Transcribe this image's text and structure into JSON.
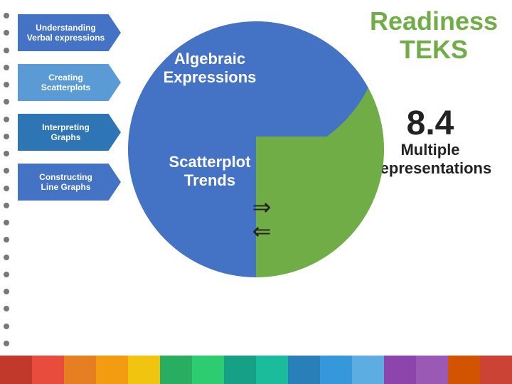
{
  "page": {
    "title": "Readiness TEKS",
    "subtitle_number": "8.4",
    "subtitle_label": "Multiple\nRepresentations",
    "readiness_line1": "Readiness",
    "readiness_line2": "TEKS",
    "circle": {
      "text1_line1": "Algebraic",
      "text1_line2": "Expressions",
      "text2_line1": "Scatterplot",
      "text2_line2": "Trends"
    },
    "arrows": [
      {
        "label": "Understanding\nVerbal expressions",
        "color": "blue1"
      },
      {
        "label": "Creating\nScatterplots",
        "color": "blue2"
      },
      {
        "label": "Interpreting\nGraphs",
        "color": "blue3"
      },
      {
        "label": "Constructing\nLine Graphs",
        "color": "blue4"
      }
    ],
    "colorbar": [
      "#C0392B",
      "#E74C3C",
      "#E67E22",
      "#F39C12",
      "#27AE60",
      "#2ECC71",
      "#16A085",
      "#1ABC9C",
      "#2980B9",
      "#3498DB",
      "#8E44AD",
      "#9B59B6",
      "#D35400",
      "#E74C3C",
      "#C0392B",
      "#27AE60"
    ]
  }
}
